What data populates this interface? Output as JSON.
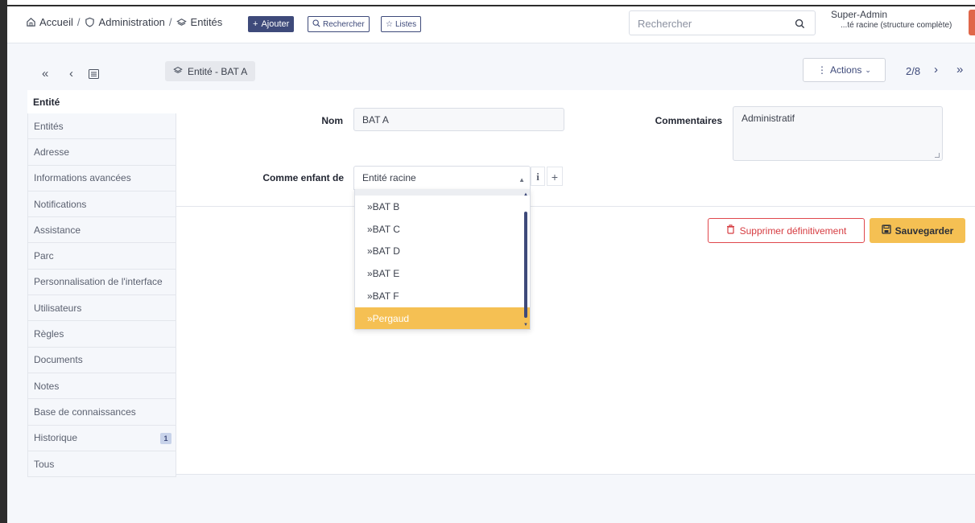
{
  "header": {
    "breadcrumbs": [
      {
        "label": "Accueil",
        "icon": "home-icon"
      },
      {
        "label": "Administration",
        "icon": "shield-icon"
      },
      {
        "label": "Entités",
        "icon": "layers-icon"
      }
    ],
    "breadcrumb_sep": "/",
    "add_label": "Ajouter",
    "search_label": "Rechercher",
    "lists_label": "Listes",
    "search_placeholder": "Rechercher",
    "user_name": "Super-Admin",
    "user_entity": "...té racine (structure complète)"
  },
  "toolbar": {
    "tab_title": "Entité - BAT A",
    "actions_label": "Actions",
    "pager": "2/8"
  },
  "tabs": [
    {
      "label": "Entité",
      "active": true
    },
    {
      "label": "Entités"
    },
    {
      "label": "Adresse"
    },
    {
      "label": "Informations avancées"
    },
    {
      "label": "Notifications"
    },
    {
      "label": "Assistance"
    },
    {
      "label": "Parc"
    },
    {
      "label": "Personnalisation de l'interface"
    },
    {
      "label": "Utilisateurs"
    },
    {
      "label": "Règles"
    },
    {
      "label": "Documents"
    },
    {
      "label": "Notes"
    },
    {
      "label": "Base de connaissances"
    },
    {
      "label": "Historique",
      "count": "1"
    },
    {
      "label": "Tous"
    }
  ],
  "form": {
    "name_label": "Nom",
    "name_value": "BAT A",
    "comments_label": "Commentaires",
    "comments_value": "Administratif",
    "parent_label": "Comme enfant de",
    "parent_value": "Entité racine"
  },
  "dropdown": {
    "options": [
      "»BAT B",
      "»BAT C",
      "»BAT D",
      "»BAT E",
      "»BAT F",
      "»Pergaud"
    ],
    "selected": "»Pergaud"
  },
  "buttons": {
    "delete_label": "Supprimer définitivement",
    "save_label": "Sauvegarder"
  },
  "colors": {
    "primary": "#3e4a7a",
    "accent": "#f5c053",
    "danger": "#d63c41"
  }
}
